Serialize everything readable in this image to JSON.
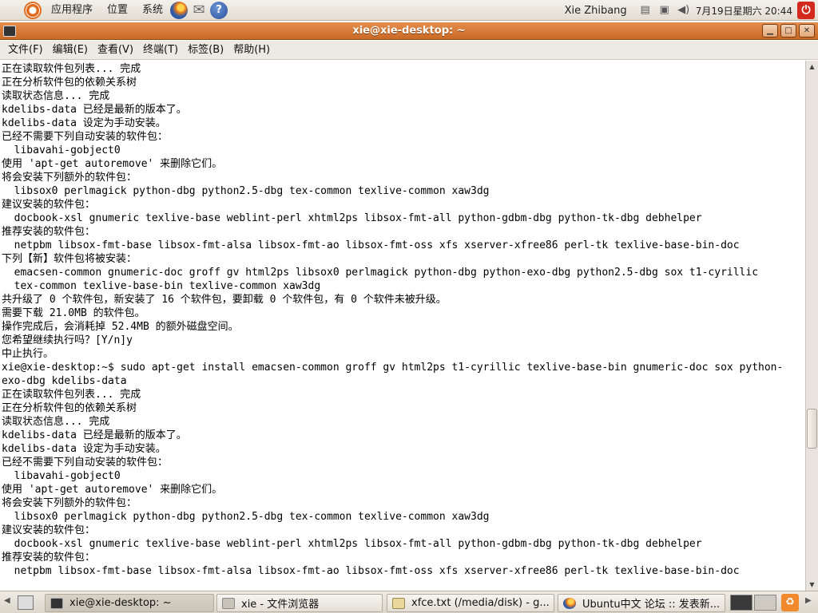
{
  "top_panel": {
    "menus": [
      "应用程序",
      "位置",
      "系统"
    ],
    "user": "Xie Zhibang",
    "clock": "7月19日星期六 20:44"
  },
  "window": {
    "title": "xie@xie-desktop: ~",
    "menu": [
      "文件(F)",
      "编辑(E)",
      "查看(V)",
      "终端(T)",
      "标签(B)",
      "帮助(H)"
    ]
  },
  "terminal_lines": [
    "正在读取软件包列表... 完成",
    "正在分析软件包的依赖关系树",
    "读取状态信息... 完成",
    "kdelibs-data 已经是最新的版本了。",
    "kdelibs-data 设定为手动安装。",
    "已经不需要下列自动安装的软件包：",
    "  libavahi-gobject0",
    "使用 'apt-get autoremove' 来删除它们。",
    "将会安装下列额外的软件包：",
    "  libsox0 perlmagick python-dbg python2.5-dbg tex-common texlive-common xaw3dg",
    "建议安装的软件包：",
    "  docbook-xsl gnumeric texlive-base weblint-perl xhtml2ps libsox-fmt-all python-gdbm-dbg python-tk-dbg debhelper",
    "推荐安装的软件包：",
    "  netpbm libsox-fmt-base libsox-fmt-alsa libsox-fmt-ao libsox-fmt-oss xfs xserver-xfree86 perl-tk texlive-base-bin-doc",
    "下列【新】软件包将被安装：",
    "  emacsen-common gnumeric-doc groff gv html2ps libsox0 perlmagick python-dbg python-exo-dbg python2.5-dbg sox t1-cyrillic",
    "  tex-common texlive-base-bin texlive-common xaw3dg",
    "共升级了 0 个软件包，新安装了 16 个软件包，要卸载 0 个软件包，有 0 个软件未被升级。",
    "需要下载 21.0MB 的软件包。",
    "操作完成后，会消耗掉 52.4MB 的额外磁盘空间。",
    "您希望继续执行吗？[Y/n]y",
    "中止执行。",
    "xie@xie-desktop:~$ sudo apt-get install emacsen-common groff gv html2ps t1-cyrillic texlive-base-bin gnumeric-doc sox python-",
    "exo-dbg kdelibs-data",
    "正在读取软件包列表... 完成",
    "正在分析软件包的依赖关系树",
    "读取状态信息... 完成",
    "kdelibs-data 已经是最新的版本了。",
    "kdelibs-data 设定为手动安装。",
    "已经不需要下列自动安装的软件包：",
    "  libavahi-gobject0",
    "使用 'apt-get autoremove' 来删除它们。",
    "将会安装下列额外的软件包：",
    "  libsox0 perlmagick python-dbg python2.5-dbg tex-common texlive-common xaw3dg",
    "建议安装的软件包：",
    "  docbook-xsl gnumeric texlive-base weblint-perl xhtml2ps libsox-fmt-all python-gdbm-dbg python-tk-dbg debhelper",
    "推荐安装的软件包：",
    "  netpbm libsox-fmt-base libsox-fmt-alsa libsox-fmt-ao libsox-fmt-oss xfs xserver-xfree86 perl-tk texlive-base-bin-doc"
  ],
  "taskbar": {
    "tasks": [
      "xie@xie-desktop: ~",
      "xie - 文件浏览器",
      "xfce.txt (/media/disk) - g...",
      "Ubuntu中文 论坛 :: 发表新..."
    ]
  },
  "colors": {
    "title_bar": "#d97a36",
    "panel": "#e9e5de"
  }
}
